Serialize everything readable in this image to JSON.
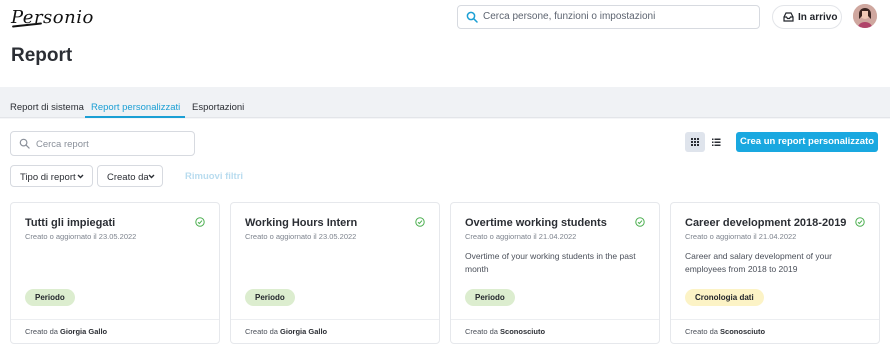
{
  "brand": {
    "logo_text": "Personio"
  },
  "header": {
    "search_placeholder": "Cerca persone, funzioni o impostazioni",
    "inbox_label": "In arrivo"
  },
  "page": {
    "title": "Report"
  },
  "tabs": [
    {
      "label": "Report di sistema",
      "active": false
    },
    {
      "label": "Report personalizzati",
      "active": true
    },
    {
      "label": "Esportazioni",
      "active": false
    }
  ],
  "toolbar": {
    "search_placeholder": "Cerca report",
    "create_label": "Crea un report personalizzato",
    "view_mode": "grid"
  },
  "filters": {
    "report_type_label": "Tipo di report",
    "created_by_label": "Creato da",
    "remove_filters_label": "Rimuovi filtri"
  },
  "colors": {
    "accent": "#19a8e0",
    "badge_period": "#dcedcf",
    "badge_timeline": "#fcf3c6",
    "check": "#4caf50"
  },
  "cards": [
    {
      "title": "Tutti gli impiegati",
      "date": "Creato o aggiornato il 23.05.2022",
      "description": "",
      "badge": "Periodo",
      "badge_color": "#dcedcf",
      "creator_prefix": "Creato da",
      "creator_name": "Giorgia Gallo"
    },
    {
      "title": "Working Hours Intern",
      "date": "Creato o aggiornato il 23.05.2022",
      "description": "",
      "badge": "Periodo",
      "badge_color": "#dcedcf",
      "creator_prefix": "Creato da",
      "creator_name": "Giorgia Gallo"
    },
    {
      "title": "Overtime working students",
      "date": "Creato o aggiornato il 21.04.2022",
      "description": "Overtime of your working students in the past month",
      "badge": "Periodo",
      "badge_color": "#dcedcf",
      "creator_prefix": "Creato da",
      "creator_name": "Sconosciuto"
    },
    {
      "title": "Career development 2018-2019",
      "date": "Creato o aggiornato il 21.04.2022",
      "description": "Career and salary development of your employees from 2018 to 2019",
      "badge": "Cronologia dati",
      "badge_color": "#fcf3c6",
      "creator_prefix": "Creato da",
      "creator_name": "Sconosciuto"
    }
  ]
}
